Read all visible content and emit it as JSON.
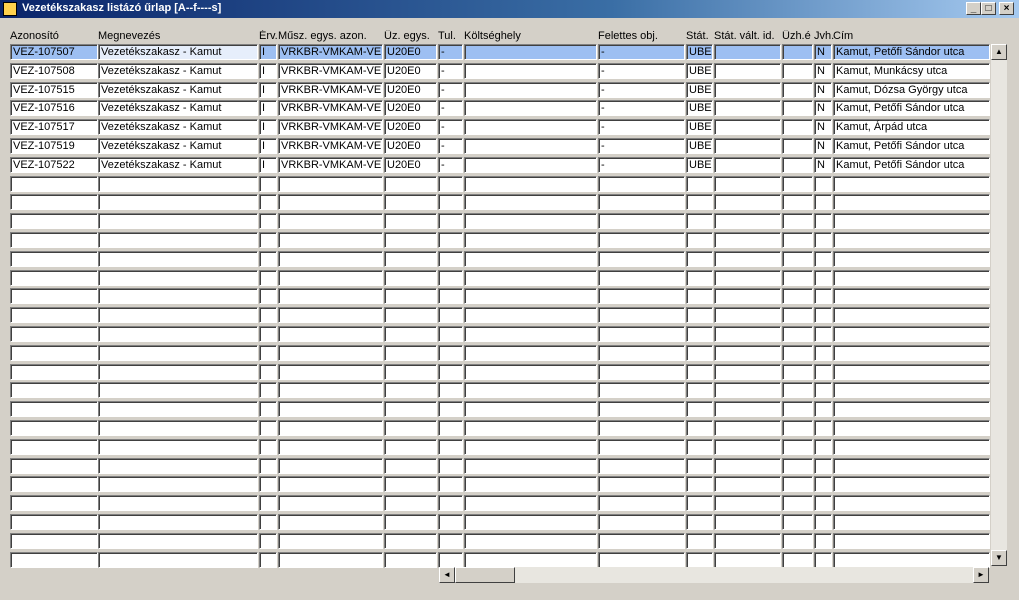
{
  "window": {
    "title": "Vezetékszakasz listázó űrlap  [A--f----s]",
    "minimize_label": "_",
    "maximize_label": "□",
    "close_label": "×"
  },
  "columns": [
    "Azonosító",
    "Megnevezés",
    "Érv.",
    "Műsz. egys. azon.",
    "Üz. egys.",
    "Tul.",
    "Költséghely",
    "Felettes obj.",
    "Stát.",
    "Stát. vált. id.",
    "Üzh.é",
    "Jvh.",
    "Cím"
  ],
  "rows": [
    [
      "VEZ-107507",
      "Vezetékszakasz - Kamut",
      "I",
      "VRKBR-VMKAM-VE",
      "U20E0",
      "-",
      "",
      "-",
      "UBE",
      "",
      "",
      "N",
      "Kamut, Petőfi Sándor utca"
    ],
    [
      "VEZ-107508",
      "Vezetékszakasz - Kamut",
      "I",
      "VRKBR-VMKAM-VE",
      "U20E0",
      "-",
      "",
      "-",
      "UBE",
      "",
      "",
      "N",
      "Kamut, Munkácsy utca"
    ],
    [
      "VEZ-107515",
      "Vezetékszakasz - Kamut",
      "I",
      "VRKBR-VMKAM-VE",
      "U20E0",
      "-",
      "",
      "-",
      "UBE",
      "",
      "",
      "N",
      "Kamut, Dózsa György utca"
    ],
    [
      "VEZ-107516",
      "Vezetékszakasz - Kamut",
      "I",
      "VRKBR-VMKAM-VE",
      "U20E0",
      "-",
      "",
      "-",
      "UBE",
      "",
      "",
      "N",
      "Kamut, Petőfi Sándor utca"
    ],
    [
      "VEZ-107517",
      "Vezetékszakasz - Kamut",
      "I",
      "VRKBR-VMKAM-VE",
      "U20E0",
      "-",
      "",
      "-",
      "UBE",
      "",
      "",
      "N",
      "Kamut, Árpád utca"
    ],
    [
      "VEZ-107519",
      "Vezetékszakasz - Kamut",
      "I",
      "VRKBR-VMKAM-VE",
      "U20E0",
      "-",
      "",
      "-",
      "UBE",
      "",
      "",
      "N",
      "Kamut, Petőfi Sándor utca"
    ],
    [
      "VEZ-107522",
      "Vezetékszakasz - Kamut",
      "I",
      "VRKBR-VMKAM-VE",
      "U20E0",
      "-",
      "",
      "-",
      "UBE",
      "",
      "",
      "N",
      "Kamut, Petőfi Sándor utca"
    ]
  ],
  "empty_row_count": 21,
  "selected_row": 0,
  "selected_cell_text": "Vezetékszakasz - Kamut",
  "scrollbars": {
    "up_icon": "▲",
    "down_icon": "▼",
    "left_icon": "◄",
    "right_icon": "►"
  },
  "colors": {
    "titlebar": "#0a246a",
    "selected_row": "#9dbff2",
    "window_bg": "#d4d0c8"
  }
}
